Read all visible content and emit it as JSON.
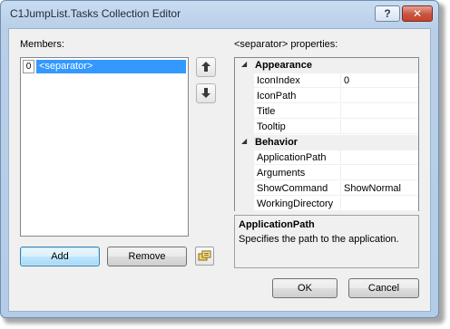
{
  "window": {
    "title": "C1JumpList.Tasks Collection Editor",
    "help_glyph": "?",
    "close_glyph": "✕"
  },
  "members": {
    "label": "Members:",
    "items": [
      {
        "index": "0",
        "label": "<separator>",
        "selected": true
      }
    ],
    "move_up_glyph": "🡅",
    "move_down_glyph": "🡇",
    "add_label": "Add",
    "remove_label": "Remove"
  },
  "properties": {
    "header": "<separator> properties:",
    "categories": [
      {
        "name": "Appearance",
        "rows": [
          {
            "name": "IconIndex",
            "value": "0"
          },
          {
            "name": "IconPath",
            "value": ""
          },
          {
            "name": "Title",
            "value": ""
          },
          {
            "name": "Tooltip",
            "value": ""
          }
        ]
      },
      {
        "name": "Behavior",
        "rows": [
          {
            "name": "ApplicationPath",
            "value": ""
          },
          {
            "name": "Arguments",
            "value": ""
          },
          {
            "name": "ShowCommand",
            "value": "ShowNormal"
          },
          {
            "name": "WorkingDirectory",
            "value": ""
          }
        ]
      }
    ],
    "description": {
      "title": "ApplicationPath",
      "text": "Specifies the path to the application."
    }
  },
  "footer": {
    "ok_label": "OK",
    "cancel_label": "Cancel"
  },
  "colors": {
    "selection": "#3399ff",
    "title_bar": "#c9dcf1",
    "close_button": "#c9422b"
  }
}
